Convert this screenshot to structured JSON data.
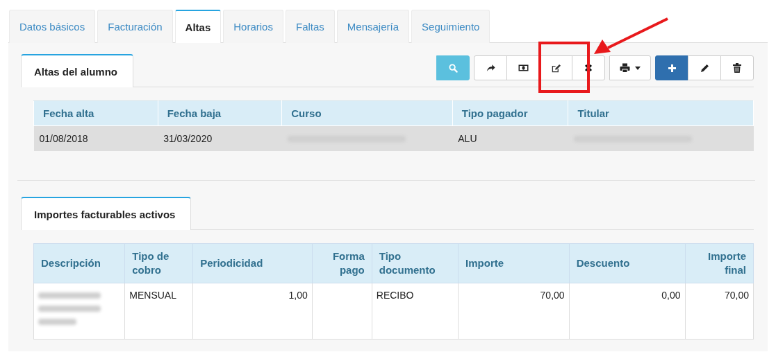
{
  "tabs": [
    {
      "label": "Datos básicos",
      "selected": false
    },
    {
      "label": "Facturación",
      "selected": false
    },
    {
      "label": "Altas",
      "selected": true
    },
    {
      "label": "Horarios",
      "selected": false
    },
    {
      "label": "Faltas",
      "selected": false
    },
    {
      "label": "Mensajería",
      "selected": false
    },
    {
      "label": "Seguimiento",
      "selected": false
    }
  ],
  "altas": {
    "subtab": {
      "label": "Altas del alumno",
      "selected": true
    },
    "toolbar": [
      [
        {
          "kind": "search"
        }
      ],
      [
        {
          "kind": "forward"
        },
        {
          "kind": "money"
        },
        {
          "kind": "edit"
        },
        {
          "kind": "cancel"
        }
      ],
      [
        {
          "kind": "print"
        }
      ],
      [
        {
          "kind": "add"
        },
        {
          "kind": "pencil"
        },
        {
          "kind": "trash"
        }
      ]
    ],
    "table": {
      "columns": [
        "Fecha alta",
        "Fecha baja",
        "Curso",
        "Tipo pagador",
        "Titular"
      ],
      "rows": [
        {
          "selected": true,
          "cells": [
            {
              "kind": "text",
              "text": "01/08/2018"
            },
            {
              "kind": "text",
              "text": "31/03/2020"
            },
            {
              "kind": "blurred"
            },
            {
              "kind": "text",
              "text": "ALU"
            },
            {
              "kind": "blurred"
            }
          ]
        }
      ]
    }
  },
  "importes": {
    "subtab": {
      "label": "Importes facturables activos",
      "selected": true
    },
    "table": {
      "columns": [
        "Descripción",
        "Tipo de cobro",
        "Periodicidad",
        "Forma pago",
        "Tipo documento",
        "Importe",
        "Descuento",
        "Importe final"
      ],
      "rows": [
        {
          "cells": [
            {
              "kind": "blurred_paragraph"
            },
            {
              "kind": "text",
              "text": "MENSUAL"
            },
            {
              "kind": "number",
              "text": "1,00"
            },
            {
              "kind": "empty"
            },
            {
              "kind": "text",
              "text": "RECIBO"
            },
            {
              "kind": "number",
              "text": "70,00"
            },
            {
              "kind": "number",
              "text": "0,00"
            },
            {
              "kind": "number",
              "text": "70,00"
            }
          ]
        }
      ]
    }
  },
  "annotation": {
    "kind": "box_with_arrow"
  }
}
